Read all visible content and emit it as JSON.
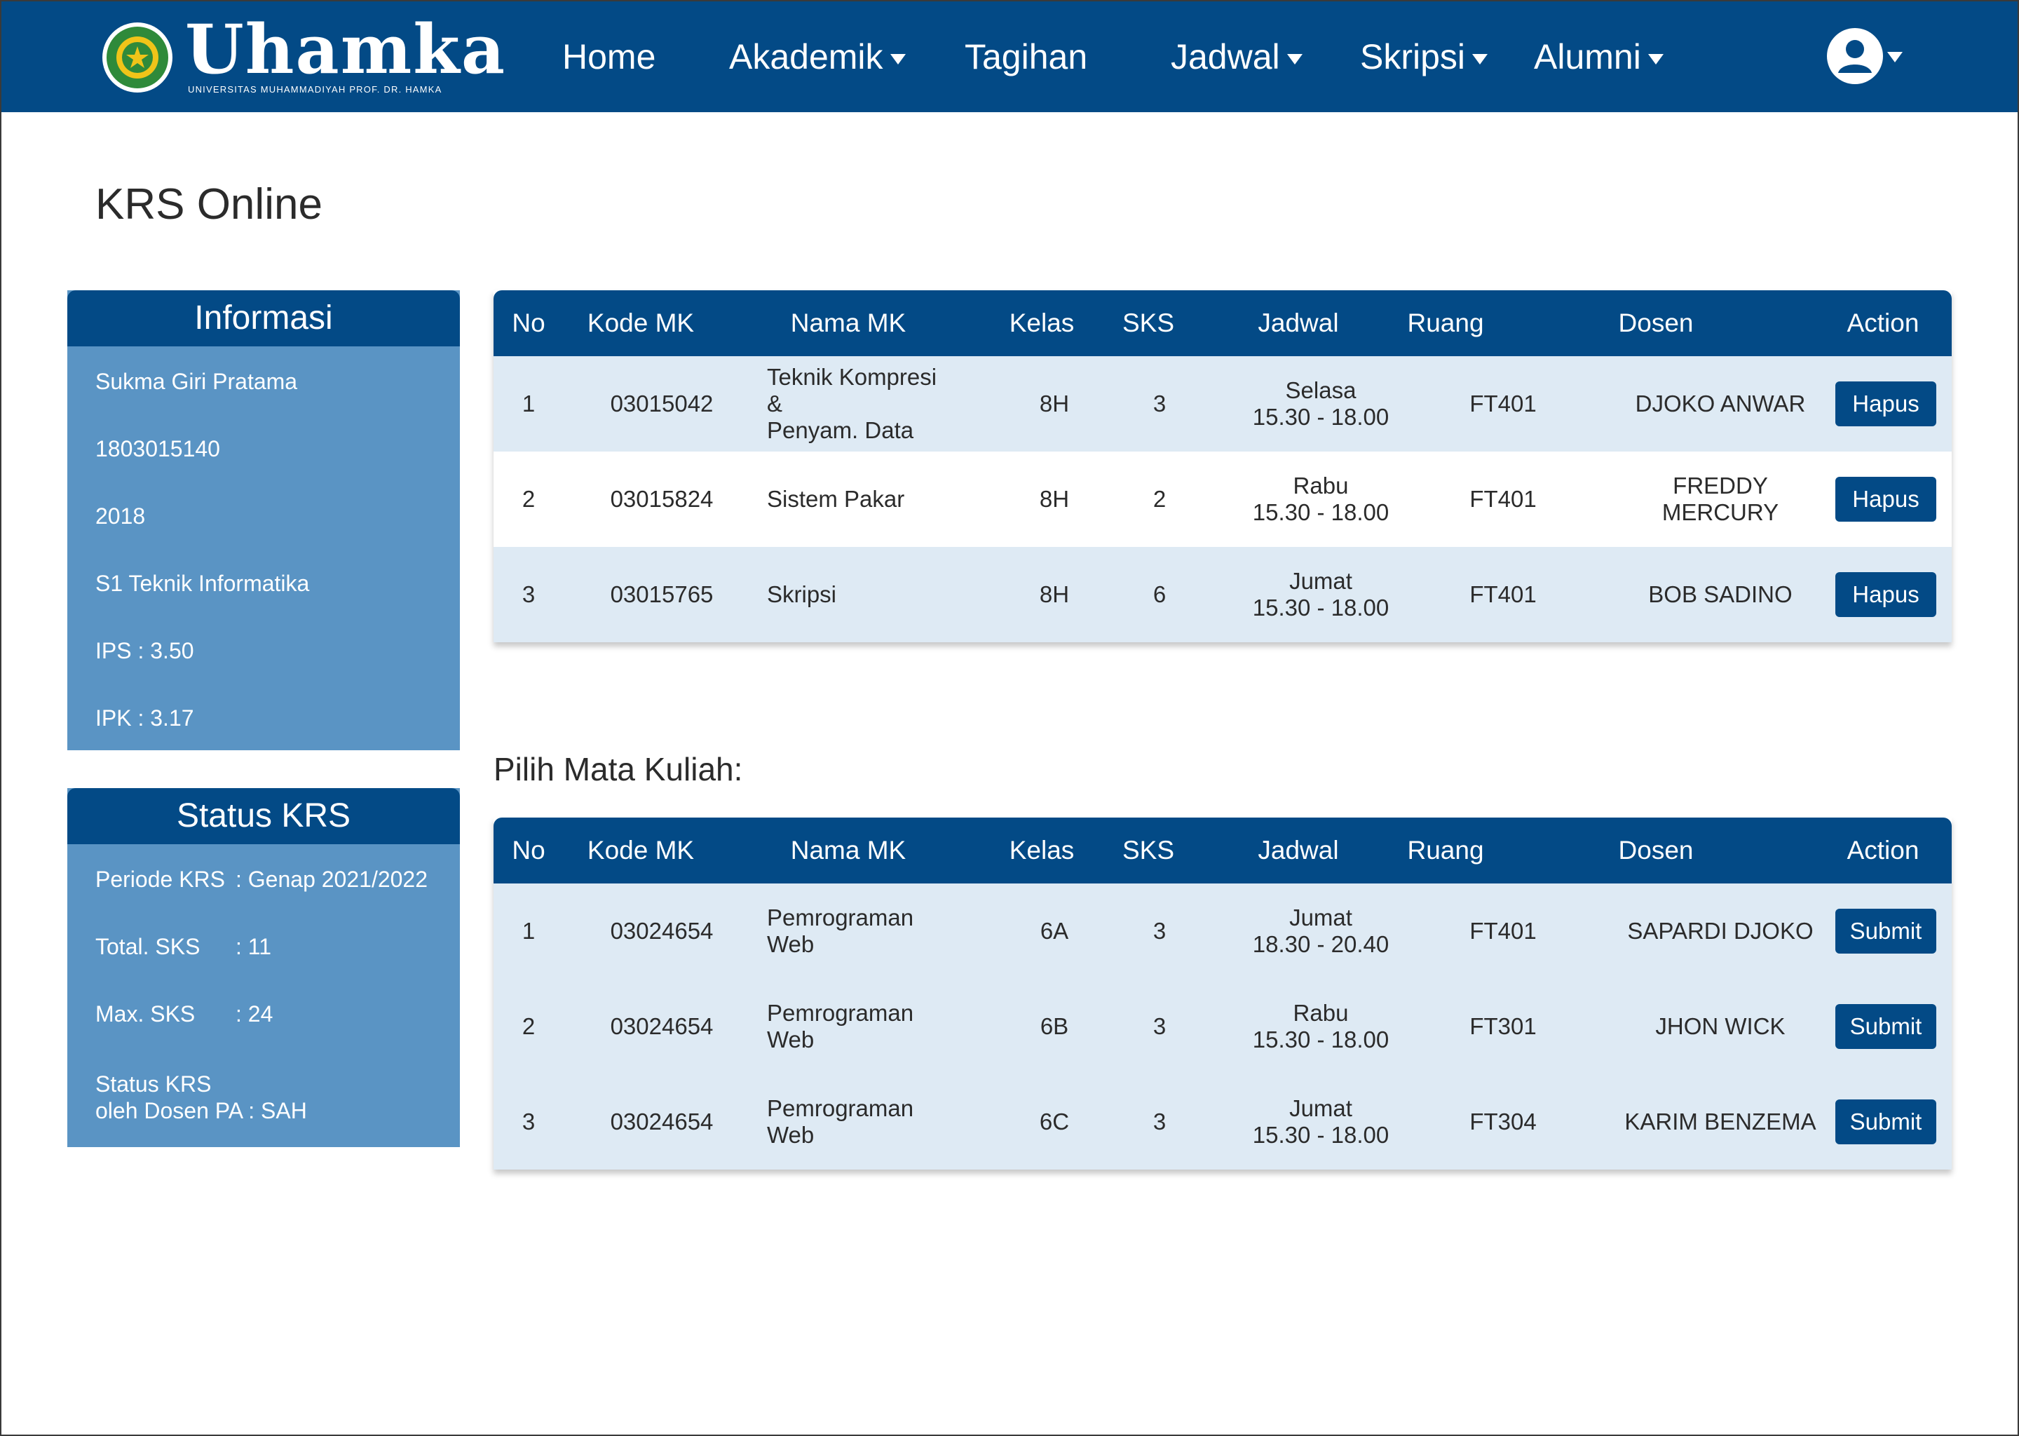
{
  "app": {
    "logo_text": "Uhamka",
    "logo_subtitle": "UNIVERSITAS MUHAMMADIYAH PROF. DR. HAMKA",
    "brand_color": "#034a86",
    "panel_color": "#5a94c4",
    "row_tint": "#deeaf4"
  },
  "nav": {
    "items": [
      {
        "label": "Home",
        "has_dropdown": false
      },
      {
        "label": "Akademik",
        "has_dropdown": true
      },
      {
        "label": "Tagihan",
        "has_dropdown": false
      },
      {
        "label": "Jadwal",
        "has_dropdown": true
      },
      {
        "label": "Skripsi",
        "has_dropdown": true
      },
      {
        "label": "Alumni",
        "has_dropdown": true
      }
    ],
    "user_icon": "user-circle-icon"
  },
  "page": {
    "title": "KRS Online"
  },
  "info_panel": {
    "title": "Informasi",
    "lines": [
      "Sukma Giri Pratama",
      "1803015140",
      "2018",
      "S1 Teknik Informatika",
      "IPS : 3.50",
      "IPK : 3.17"
    ]
  },
  "status_panel": {
    "title": "Status KRS",
    "rows": [
      {
        "key": "Periode KRS",
        "value": ": Genap 2021/2022"
      },
      {
        "key": "Total. SKS",
        "value": ": 11"
      },
      {
        "key": "Max. SKS",
        "value": ": 24"
      }
    ],
    "pa_line1": "Status KRS",
    "pa_line2": "oleh Dosen PA : SAH"
  },
  "table_headers": [
    "No",
    "Kode MK",
    "Nama MK",
    "Kelas",
    "SKS",
    "Jadwal",
    "Ruang",
    "Dosen",
    "Action"
  ],
  "registered": {
    "rows": [
      {
        "no": "1",
        "kode": "03015042",
        "nama1": "Teknik Kompresi &",
        "nama2": "Penyam. Data",
        "kelas": "8H",
        "sks": "3",
        "hari": "Selasa",
        "jam": "15.30 - 18.00",
        "ruang": "FT401",
        "dosen1": "DJOKO ANWAR",
        "dosen2": "",
        "action": "Hapus"
      },
      {
        "no": "2",
        "kode": "03015824",
        "nama1": "Sistem Pakar",
        "nama2": "",
        "kelas": "8H",
        "sks": "2",
        "hari": "Rabu",
        "jam": "15.30 - 18.00",
        "ruang": "FT401",
        "dosen1": "FREDDY",
        "dosen2": "MERCURY",
        "action": "Hapus"
      },
      {
        "no": "3",
        "kode": "03015765",
        "nama1": "Skripsi",
        "nama2": "",
        "kelas": "8H",
        "sks": "6",
        "hari": "Jumat",
        "jam": "15.30 - 18.00",
        "ruang": "FT401",
        "dosen1": "BOB SADINO",
        "dosen2": "",
        "action": "Hapus"
      }
    ]
  },
  "choose": {
    "title": "Pilih Mata Kuliah:",
    "rows": [
      {
        "no": "1",
        "kode": "03024654",
        "nama1": "Pemrograman Web",
        "nama2": "",
        "kelas": "6A",
        "sks": "3",
        "hari": "Jumat",
        "jam": "18.30 - 20.40",
        "ruang": "FT401",
        "dosen1": "SAPARDI DJOKO",
        "dosen2": "",
        "action": "Submit"
      },
      {
        "no": "2",
        "kode": "03024654",
        "nama1": "Pemrograman Web",
        "nama2": "",
        "kelas": "6B",
        "sks": "3",
        "hari": "Rabu",
        "jam": "15.30 - 18.00",
        "ruang": "FT301",
        "dosen1": "JHON WICK",
        "dosen2": "",
        "action": "Submit"
      },
      {
        "no": "3",
        "kode": "03024654",
        "nama1": "Pemrograman Web",
        "nama2": "",
        "kelas": "6C",
        "sks": "3",
        "hari": "Jumat",
        "jam": "15.30 - 18.00",
        "ruang": "FT304",
        "dosen1": "KARIM BENZEMA",
        "dosen2": "",
        "action": "Submit"
      }
    ]
  }
}
